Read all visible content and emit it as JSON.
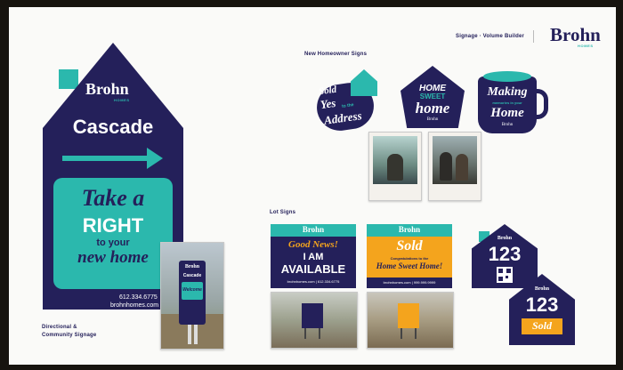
{
  "header": {
    "caption": "Signage · Volume Builder",
    "brand": "Brohn",
    "brand_sub": "HOMES"
  },
  "sections": {
    "homeowner": "New Homeowner Signs",
    "lot": "Lot Signs",
    "directional": "Directional &",
    "directional2": "Community Signage"
  },
  "directional_sign": {
    "brand": "Brohn",
    "brand_sub": "HOMES",
    "community": "Cascade",
    "line1": "Take a",
    "line2": "RIGHT",
    "line3": "to your",
    "line4": "new home",
    "phone": "612.334.6775",
    "web": "brohnhomes.com"
  },
  "post_sign": {
    "brand": "Brohn",
    "community": "Cascade",
    "line": "Welcome"
  },
  "homeowner_signs": [
    {
      "line1": "Sold",
      "line2": "Yes",
      "line3": "to the",
      "line4": "Address"
    },
    {
      "line1": "HOME",
      "line2": "SWEET",
      "line3": "home",
      "line4": "Brohn"
    },
    {
      "line1": "Making",
      "line2": "memories in your",
      "line3": "Home",
      "line4": "Brohn"
    }
  ],
  "lot_signs": {
    "available": {
      "brand": "Brohn",
      "line1": "Good News!",
      "line2": "I AM",
      "line3": "AVAILABLE",
      "footer": "brohnhomes.com | 612.334.6775"
    },
    "sold": {
      "brand": "Brohn",
      "line1": "Sold",
      "line2": "Congratulations to the",
      "line3": "Home Sweet Home!",
      "footer": "brohnhomes.com | 999.999.9999"
    },
    "number_sign_1": {
      "brand": "Brohn",
      "number": "123"
    },
    "number_sign_2": {
      "brand": "Brohn",
      "number": "123",
      "tag": "Sold"
    }
  },
  "colors": {
    "navy": "#24205a",
    "teal": "#2bb8ad",
    "orange": "#f4a41d"
  }
}
